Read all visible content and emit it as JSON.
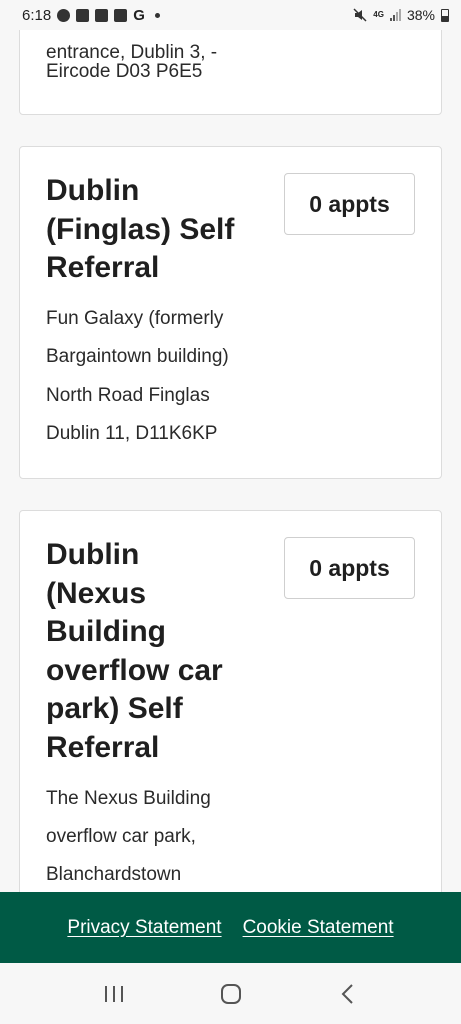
{
  "status_bar": {
    "time": "6:18",
    "left_icons": [
      "sync-icon",
      "app-icon",
      "checkbox-icon",
      "image-icon",
      "google-icon",
      "dot-icon"
    ],
    "g_label": "G",
    "network": "4G",
    "battery": "38%"
  },
  "cards": [
    {
      "address_lines": [
        "entrance, Dublin 3, -",
        "Eircode D03 P6E5"
      ]
    },
    {
      "title_lines": [
        "Dublin",
        "(Finglas) Self",
        "Referral"
      ],
      "appt_label": "0 appts",
      "address_lines": [
        "Fun Galaxy (formerly",
        "Bargaintown building)",
        "North Road Finglas",
        "Dublin 11, D11K6KP"
      ]
    },
    {
      "title_lines": [
        "Dublin",
        "(Nexus",
        "Building",
        "overflow car",
        "park) Self",
        "Referral"
      ],
      "appt_label": "0 appts",
      "address_lines": [
        "The Nexus Building",
        "overflow car park,",
        "Blanchardstown"
      ]
    }
  ],
  "footer": {
    "privacy": "Privacy Statement",
    "cookie": "Cookie Statement",
    "color": "#005a45"
  },
  "nav": {
    "recents": "recents-icon",
    "home": "home-icon",
    "back": "back-icon"
  }
}
